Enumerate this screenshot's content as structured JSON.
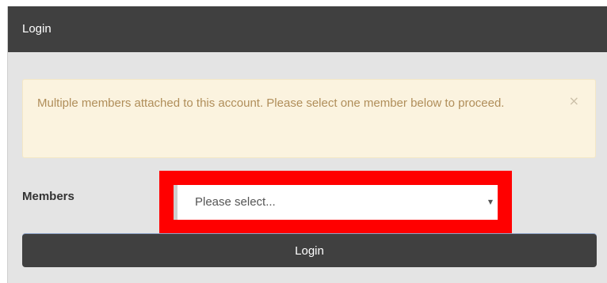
{
  "dialog": {
    "title": "Login"
  },
  "alert": {
    "message": "Multiple members attached to this account. Please select one member below to proceed.",
    "close_glyph": "×"
  },
  "form": {
    "members_label": "Members",
    "members_select": {
      "selected_value": "Please select...",
      "arrow_glyph": "▼"
    },
    "login_label": "Login"
  },
  "colors": {
    "header_bg": "#404040",
    "panel_bg": "#e4e4e4",
    "alert_bg": "#fbf3df",
    "alert_text": "#b08e5a",
    "highlight": "#ff0000",
    "button_bg": "#404040"
  }
}
